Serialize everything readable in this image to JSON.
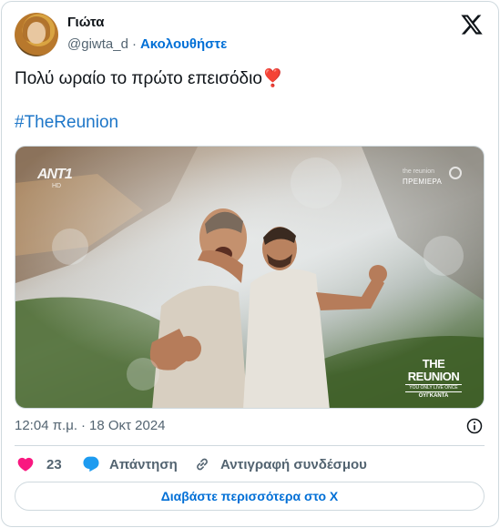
{
  "author": {
    "display_name": "Γιώτα",
    "handle": "@giwta_d",
    "separator": "·",
    "follow_label": "Ακολουθήστε"
  },
  "tweet": {
    "text": "Πολύ ωραίο το πρώτο επεισόδιο",
    "emoji": "❣️",
    "hashtag": "#TheReunion"
  },
  "media": {
    "channel_logo": "ANT1",
    "channel_sub": "HD",
    "premiere_top": "the reunion",
    "premiere_label": "ΠΡΕΜΙΕΡΑ",
    "show_title": "THE REUNION",
    "show_subtitle": "YOU ONLY LIVE ONCE",
    "show_day": "ΟΥΓΚΑΝΤΑ"
  },
  "meta": {
    "time": "12:04 π.μ.",
    "separator": "·",
    "date": "18 Οκτ 2024"
  },
  "actions": {
    "like_count": "23",
    "reply_label": "Απάντηση",
    "copy_link_label": "Αντιγραφή συνδέσμου"
  },
  "read_more_label": "Διαβάστε περισσότερα στο X",
  "colors": {
    "accent": "#006fd6",
    "hashtag": "#1d76c8",
    "like": "#f91880",
    "reply": "#1d9bf0",
    "muted": "#536471",
    "border": "#cfd9de"
  },
  "icons": {
    "logo": "x-logo-icon",
    "like": "heart-icon",
    "reply": "speech-bubble-icon",
    "copy": "link-icon",
    "info": "info-icon"
  }
}
